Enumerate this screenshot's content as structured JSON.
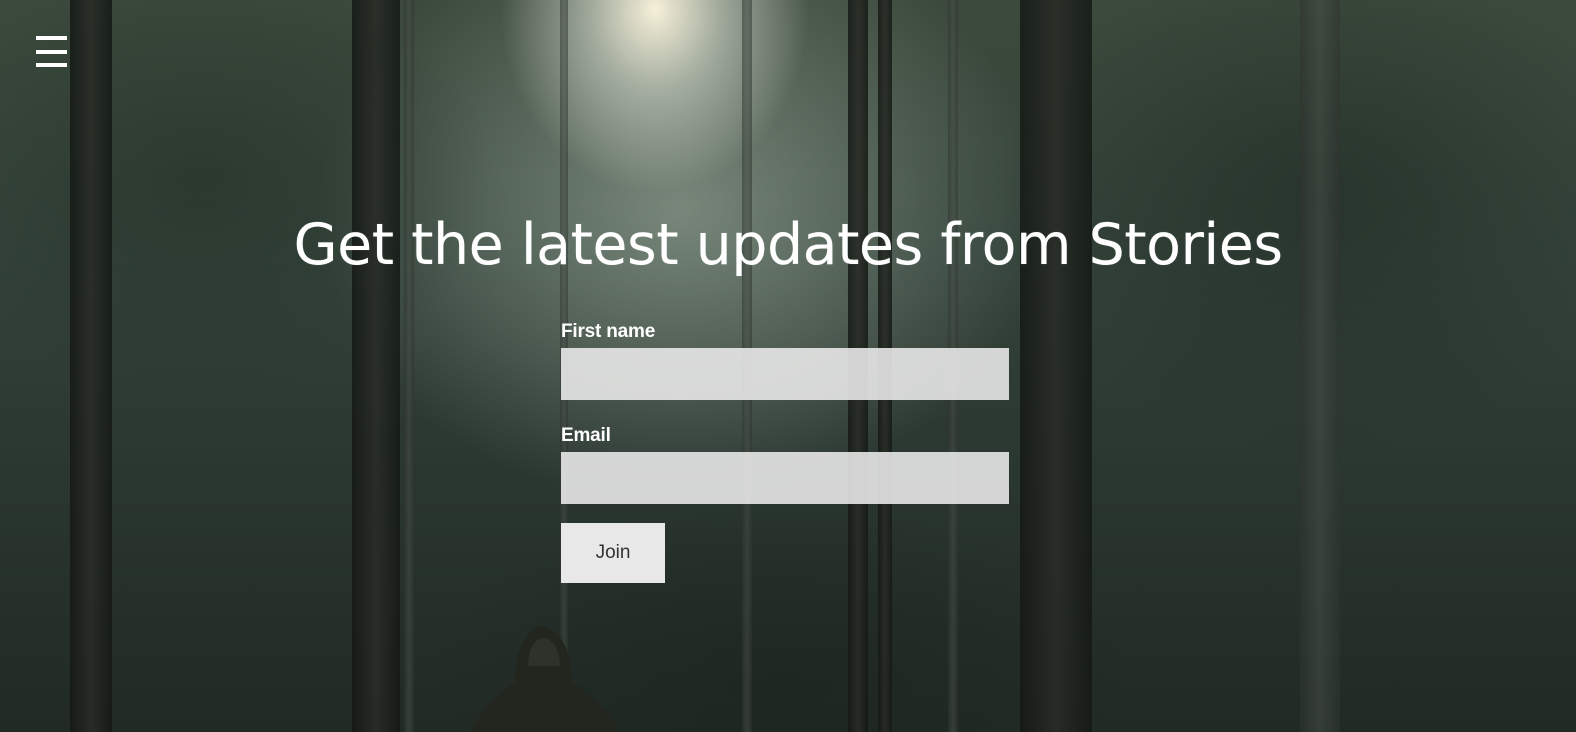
{
  "header": {
    "menu_icon": "hamburger-menu-icon"
  },
  "hero": {
    "headline": "Get the latest updates from Stories"
  },
  "form": {
    "first_name_label": "First name",
    "first_name_value": "",
    "email_label": "Email",
    "email_value": "",
    "join_label": "Join"
  },
  "colors": {
    "text": "#ffffff",
    "input_background": "#ececec",
    "button_background": "#e8e8e8",
    "button_text": "#333333"
  }
}
